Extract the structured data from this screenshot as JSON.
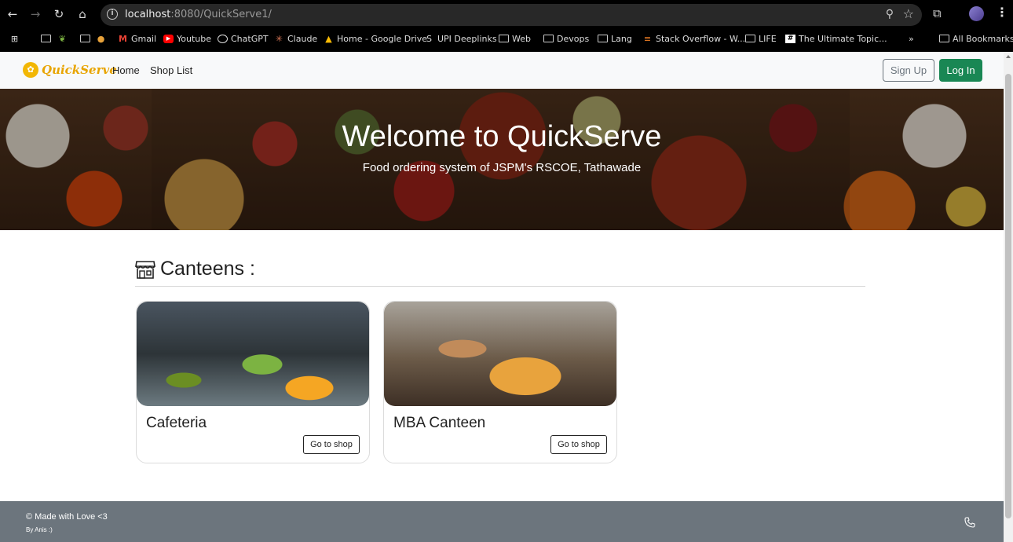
{
  "browser": {
    "url_host": "localhost",
    "url_rest": ":8080/QuickServe1/",
    "bookmarks": [
      {
        "label": "",
        "icon": "apps-icon"
      },
      {
        "label": "",
        "icon": "folder-icon"
      },
      {
        "label": "",
        "icon": "sprout-icon"
      },
      {
        "label": "",
        "icon": "folder-icon"
      },
      {
        "label": "",
        "icon": "cookie-icon"
      },
      {
        "label": "Gmail",
        "icon": "gmail-icon"
      },
      {
        "label": "Youtube",
        "icon": "youtube-icon"
      },
      {
        "label": "ChatGPT",
        "icon": "chatgpt-icon"
      },
      {
        "label": "Claude",
        "icon": "claude-icon"
      },
      {
        "label": "Home - Google Drive",
        "icon": "drive-icon"
      },
      {
        "label": "UPI Deeplinks",
        "icon": "upi-icon"
      },
      {
        "label": "Web",
        "icon": "folder-icon"
      },
      {
        "label": "Devops",
        "icon": "folder-icon"
      },
      {
        "label": "Lang",
        "icon": "folder-icon"
      },
      {
        "label": "Stack Overflow - W...",
        "icon": "stackoverflow-icon"
      },
      {
        "label": "LIFE",
        "icon": "folder-icon"
      },
      {
        "label": "The Ultimate Topic...",
        "icon": "hashtag-icon"
      }
    ],
    "overflow_label": "»",
    "all_bookmarks_label": "All Bookmarks"
  },
  "navbar": {
    "logo_text": "QuickServe",
    "links": [
      "Home",
      "Shop List"
    ],
    "signup_label": "Sign Up",
    "login_label": "Log In"
  },
  "hero": {
    "title": "Welcome to QuickServe",
    "subtitle": "Food ordering system of JSPM's RSCOE, Tathawade"
  },
  "canteens": {
    "heading": "Canteens :",
    "items": [
      {
        "name": "Cafeteria",
        "button_label": "Go to shop"
      },
      {
        "name": "MBA Canteen",
        "button_label": "Go to shop"
      }
    ]
  },
  "footer": {
    "line1": "© Made with Love <3",
    "line2": "By Anis :)"
  },
  "colors": {
    "login_button": "#198754",
    "footer_bg": "#6c757d",
    "logo": "#e8a400"
  }
}
